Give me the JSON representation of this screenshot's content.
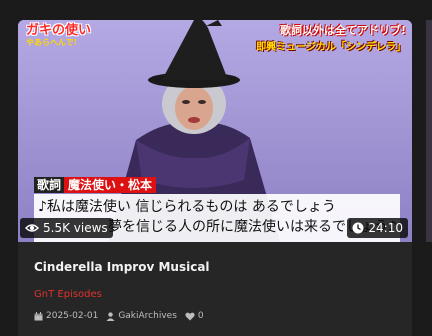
{
  "thumbnail": {
    "logo_line1": "ガキの使い",
    "logo_line2": "やあらへんで!",
    "caption_line1": "歌詞以外は全てアドリブ!",
    "caption_line2": "即興ミュージカル「シンデレラ」",
    "lyric_tag_label": "歌詞",
    "lyric_tag_name": "魔法使い・松本",
    "lyric_line1": "♪私は魔法使い 信じられるものは あるでしょう",
    "lyric_line2": "夢を信じる人の所に魔法使いは来るでしょう♪",
    "views_icon": "eye-icon",
    "views": "5.5K views",
    "duration_icon": "clock-icon",
    "duration": "24:10"
  },
  "video": {
    "title": "Cinderella Improv Musical",
    "category": "GnT Episodes",
    "date_icon": "calendar-icon",
    "date": "2025-02-01",
    "author_icon": "user-icon",
    "author": "GakiArchives",
    "likes_icon": "heart-icon",
    "likes": "0"
  },
  "colors": {
    "page_bg": "#1b1b1b",
    "card_bg": "#262626",
    "category": "#e03131",
    "meta_text": "#bdbdbd"
  }
}
